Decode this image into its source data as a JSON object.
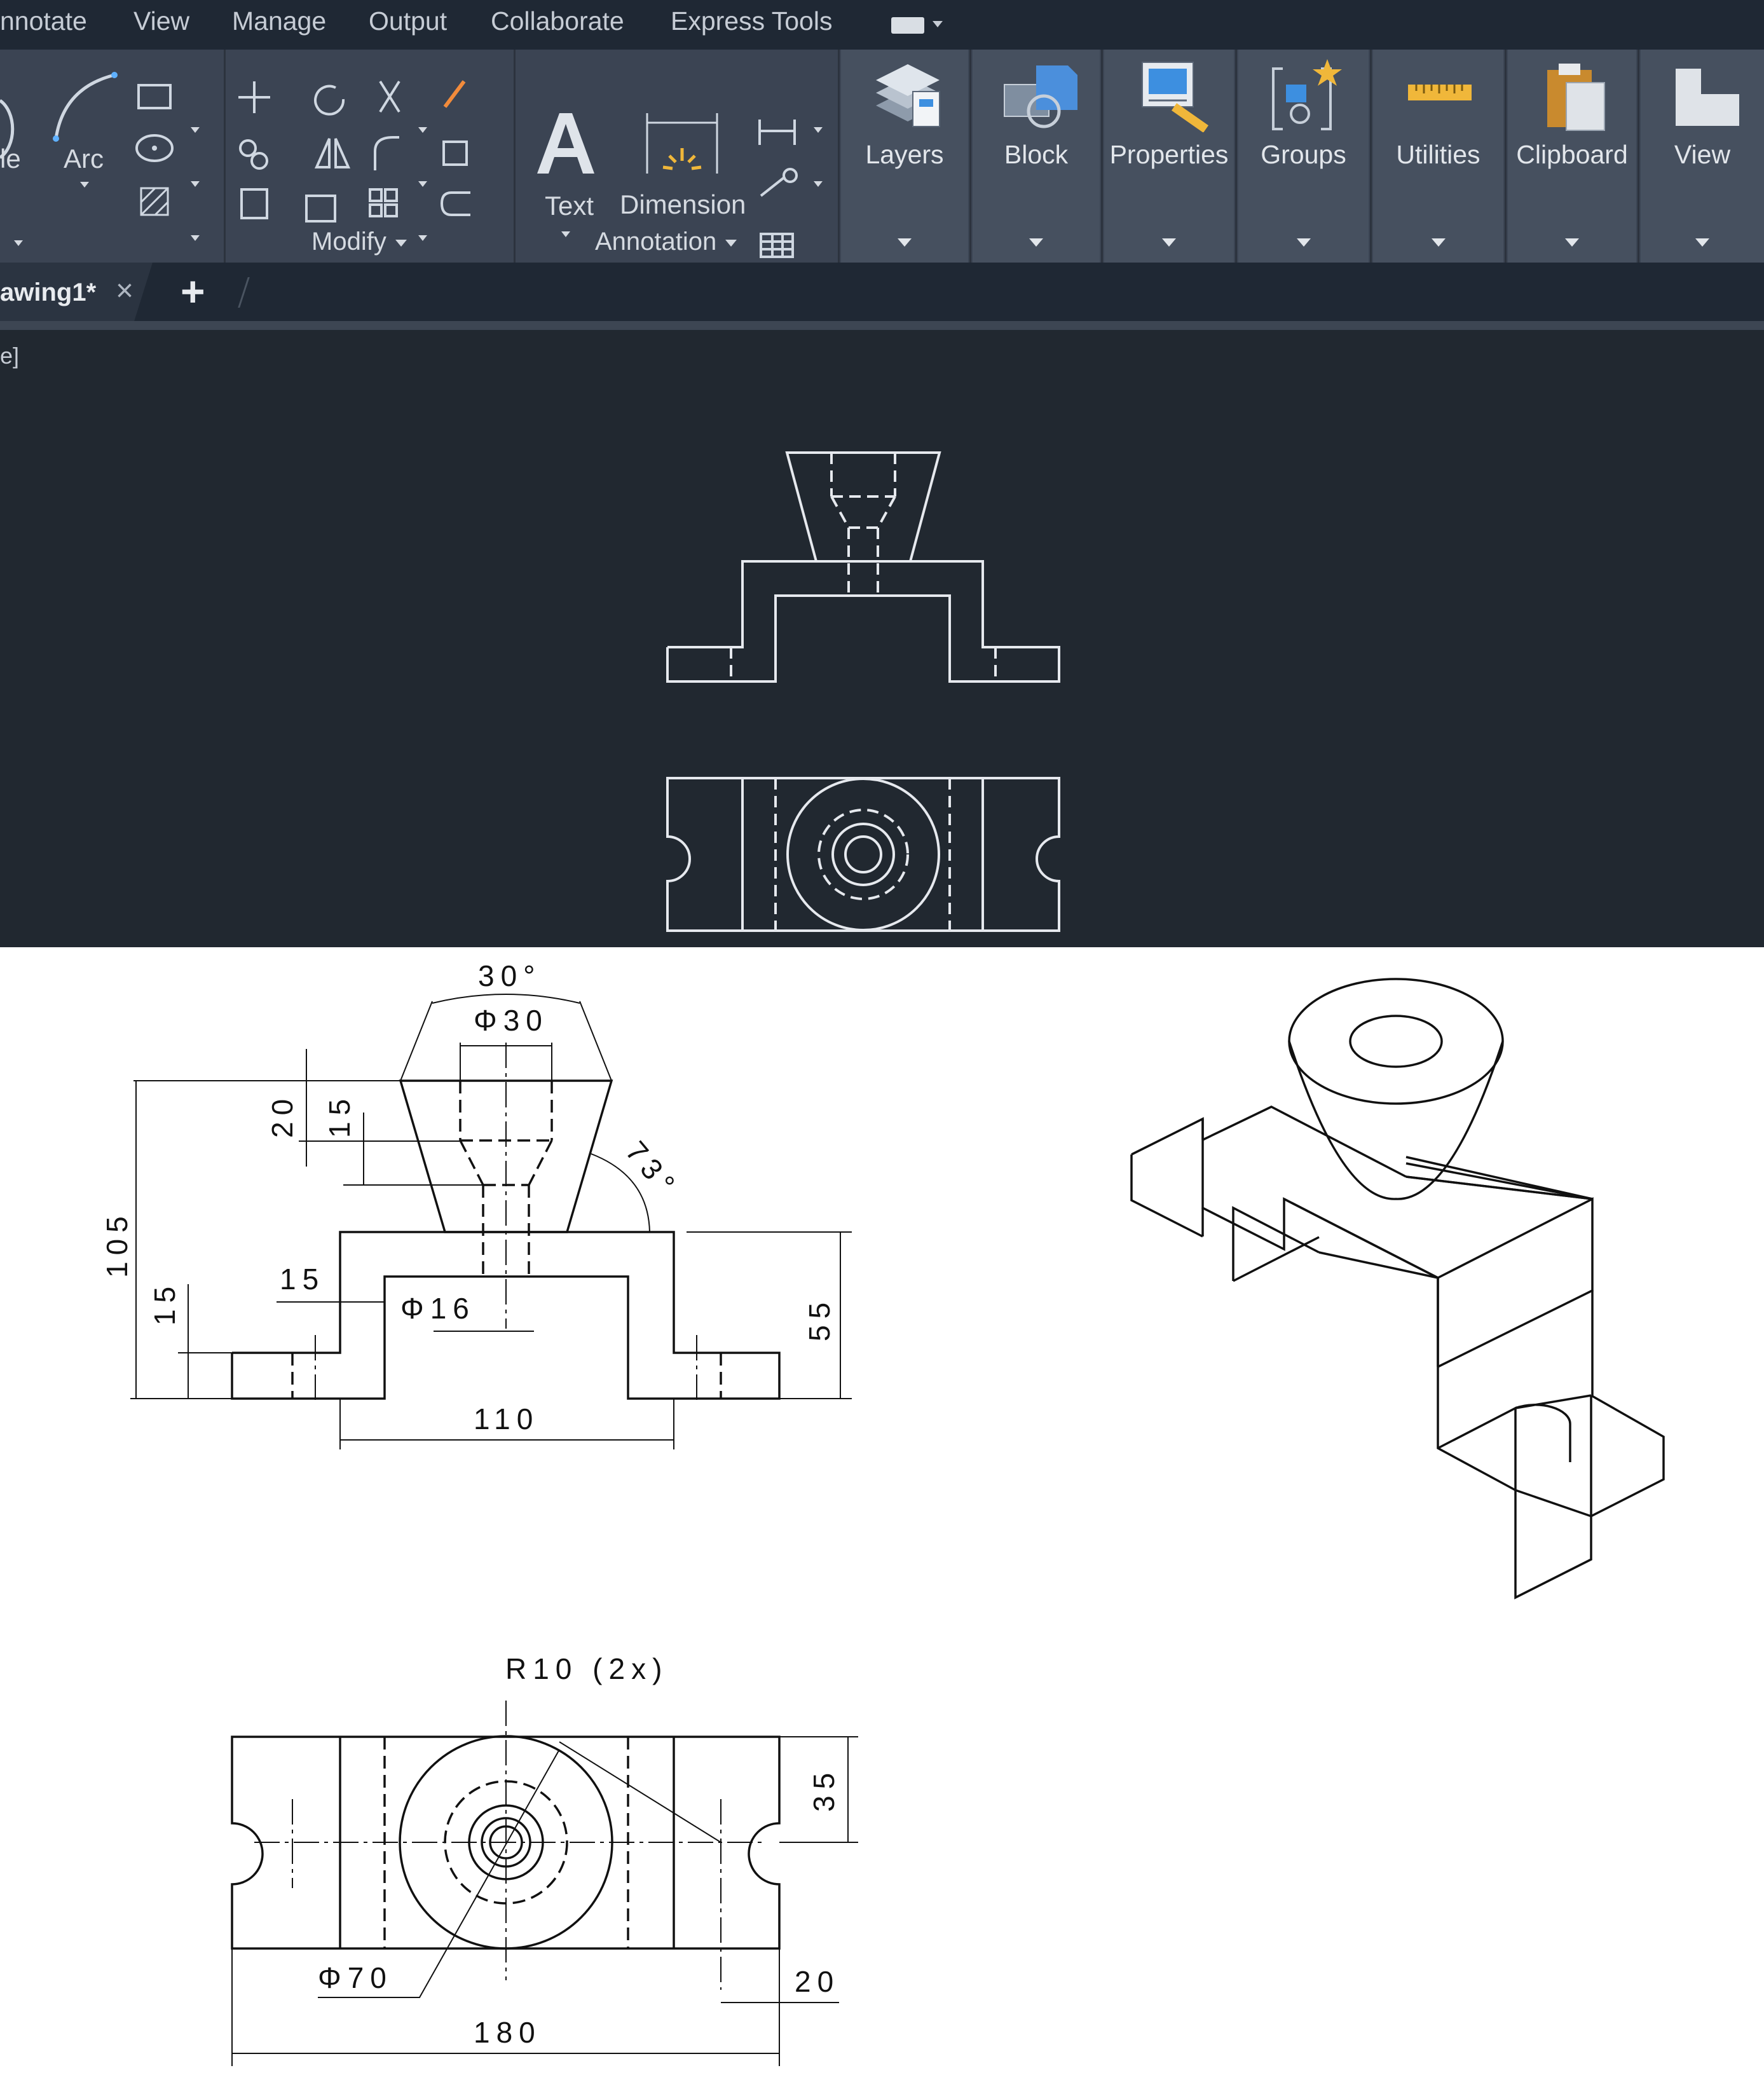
{
  "menu": {
    "items": [
      "nnotate",
      "View",
      "Manage",
      "Output",
      "Collaborate",
      "Express Tools"
    ]
  },
  "ribbon": {
    "draw_partial_label": "le",
    "arc_label": "Arc",
    "modify_title": "Modify",
    "text_label": "Text",
    "dimension_label": "Dimension",
    "annotation_title": "Annotation",
    "panels": [
      "Layers",
      "Block",
      "Properties",
      "Groups",
      "Utilities",
      "Clipboard",
      "View"
    ]
  },
  "tabs": {
    "active_tab": "awing1*",
    "close_glyph": "×",
    "new_tab_glyph": "+"
  },
  "viewport": {
    "label_fragment": "e]"
  },
  "reference_drawing": {
    "front_dimensions": [
      "30°",
      "Φ30",
      "20",
      "15",
      "73°",
      "105",
      "15",
      "15",
      "Φ16",
      "55",
      "110"
    ],
    "top_dimensions": [
      "R10 (2x)",
      "35",
      "Φ70",
      "20",
      "180"
    ]
  },
  "colors": {
    "menubar_bg": "#1f2834",
    "ribbon_bg": "#3b4453",
    "canvas_bg": "#212830",
    "linework": "#e6e9ee"
  }
}
